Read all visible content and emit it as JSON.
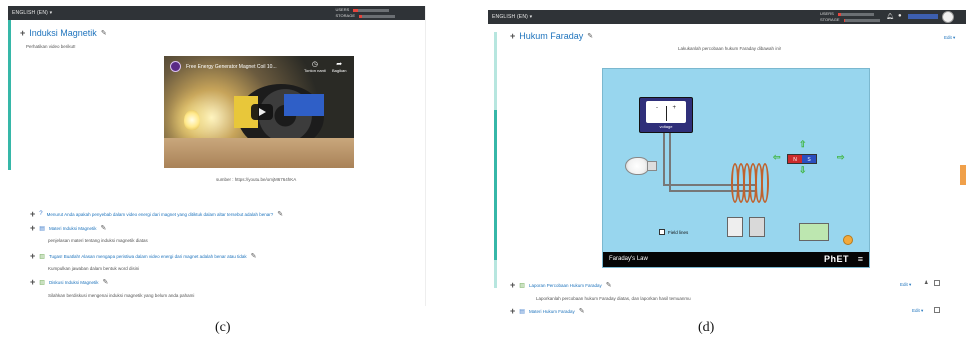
{
  "left_panel": {
    "topbar": {
      "language": "ENGLISH (EN) ▾",
      "users_label": "USERS",
      "storage_label": "STORAGE",
      "users_fill": 0.12,
      "storage_fill": 0.08
    },
    "section_title": "Induksi Magnetik",
    "intro": "Perhatikan video berikut!",
    "video": {
      "title": "Free Energy Generator Magnet Coil 10...",
      "watch_later": "Tonton nanti",
      "share": "Bagikan"
    },
    "source": "sumber : https://youtu.be/omjM6764hKA",
    "items": [
      {
        "icon": "question-icon",
        "text": "Menurut Anda apakah penyebab dalam video energi dari magnet yang ditiktuk dalam altar tersebut adalah benar?"
      },
      {
        "icon": "document-icon",
        "text": "Materi Induksi Magnetik"
      },
      {
        "desc": "penjelasan materi tentang induksi magnetik diatas"
      },
      {
        "icon": "forum-icon",
        "text": "Tugas! Buatlah! Alasan mengapa peristiwa dalam video energi dari magnet adalah benar atau tidak"
      },
      {
        "desc": "Kumpulkan jawaban dalam bentuk word disini"
      },
      {
        "icon": "forum-icon",
        "text": "Diskusi Induksi Magnetik"
      },
      {
        "desc": "Silahkan berdiskusi mengenai induksi magnetik yang belum anda pahami"
      }
    ]
  },
  "right_panel": {
    "topbar": {
      "language": "ENGLISH (EN) ▾",
      "users_label": "USERS",
      "storage_label": "STORAGE",
      "users_fill": 0.1,
      "storage_fill": 0.05
    },
    "section_title": "Hukum Faraday",
    "edit_label": "Edit ▾",
    "instruction": "Lakukanlah percobaan hukum Faraday dibawah ini!",
    "sim": {
      "meter_minus": "-",
      "meter_plus": "+",
      "meter_label": "voltage",
      "magnet_n": "N",
      "magnet_s": "S",
      "checkbox_label": "Field lines",
      "footer_label": "Faraday's Law",
      "brand": "PhET"
    },
    "items": [
      {
        "icon": "forum-icon",
        "text": "Laporan Percobaan Hukum Faraday",
        "edit": "Edit ▾"
      },
      {
        "desc": "Laporkanlah percobaan hukum Faraday diatas, dan laporkan hasil temuanmu"
      },
      {
        "icon": "document-icon",
        "text": "Materi Hukum Faraday",
        "edit": "Edit ▾"
      }
    ]
  },
  "captions": {
    "left": "(c)",
    "right": "(d)"
  }
}
